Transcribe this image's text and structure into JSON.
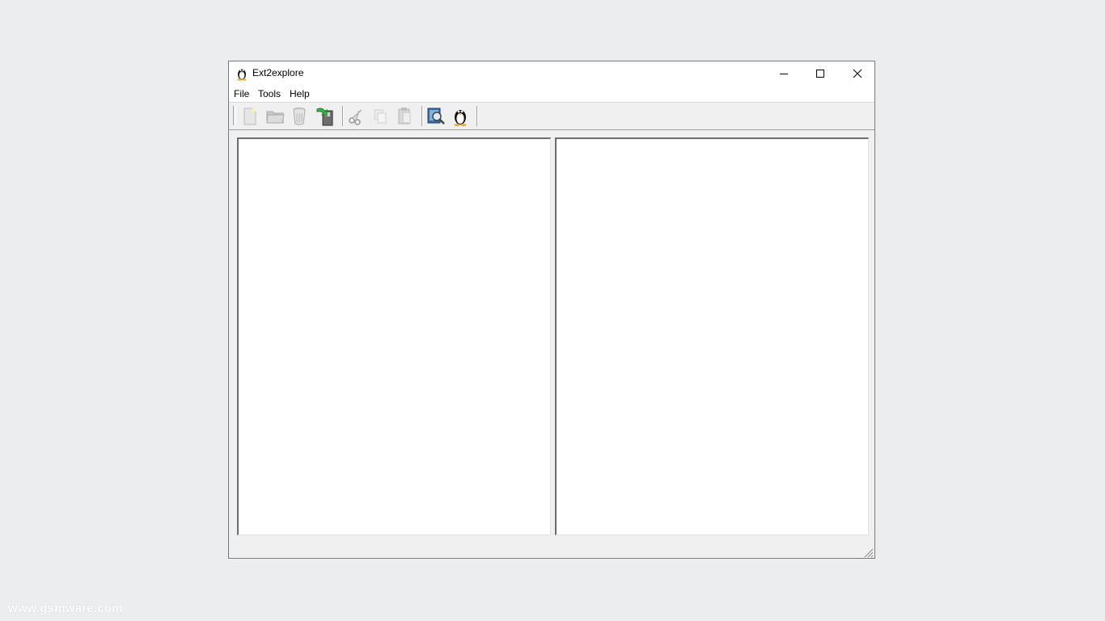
{
  "window": {
    "title": "Ext2explore",
    "controls": {
      "minimize": "minimize-icon",
      "maximize": "maximize-icon",
      "close": "close-icon"
    }
  },
  "menu": {
    "items": [
      {
        "label": "File"
      },
      {
        "label": "Tools"
      },
      {
        "label": "Help"
      }
    ]
  },
  "toolbar": {
    "buttons": [
      {
        "icon": "new-file-icon",
        "enabled": false
      },
      {
        "icon": "folder-icon",
        "enabled": false
      },
      {
        "icon": "trash-icon",
        "enabled": false
      },
      {
        "icon": "save-export-icon",
        "enabled": true
      },
      {
        "icon": "cut-icon",
        "enabled": false
      },
      {
        "icon": "copy-icon",
        "enabled": false
      },
      {
        "icon": "paste-icon",
        "enabled": false
      },
      {
        "icon": "scan-partition-icon",
        "enabled": true
      },
      {
        "icon": "linux-penguin-icon",
        "enabled": true
      }
    ]
  },
  "colors": {
    "desktop": "#ecedef",
    "window_bg": "#f0f0f0",
    "titlebar": "#ffffff",
    "pane_bg": "#ffffff"
  },
  "watermark": "www.gsmware.com"
}
